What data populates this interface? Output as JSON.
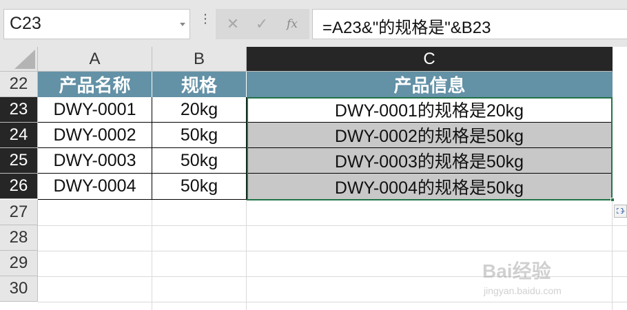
{
  "formula_bar": {
    "name_box": "C23",
    "cancel_icon": "✕",
    "enter_icon": "✓",
    "fx_label": "fx",
    "formula": "=A23&\"的规格是\"&B23"
  },
  "columns": [
    "A",
    "B",
    "C"
  ],
  "rows": [
    "22",
    "23",
    "24",
    "25",
    "26",
    "27",
    "28",
    "29",
    "30"
  ],
  "table": {
    "headers": [
      "产品名称",
      "规格",
      "产品信息"
    ],
    "data": [
      [
        "DWY-0001",
        "20kg",
        "DWY-0001的规格是20kg"
      ],
      [
        "DWY-0002",
        "50kg",
        "DWY-0002的规格是50kg"
      ],
      [
        "DWY-0003",
        "50kg",
        "DWY-0003的规格是50kg"
      ],
      [
        "DWY-0004",
        "50kg",
        "DWY-0004的规格是50kg"
      ]
    ]
  },
  "selection": {
    "active_cell": "C23",
    "range": "C23:C26"
  },
  "colors": {
    "header_fill": "#6391a6",
    "selection_border": "#217346",
    "selected_fill": "#c8c8c8",
    "active_header": "#262626"
  },
  "watermark": {
    "logo": "Bai经验",
    "url": "jingyan.baidu.com"
  }
}
